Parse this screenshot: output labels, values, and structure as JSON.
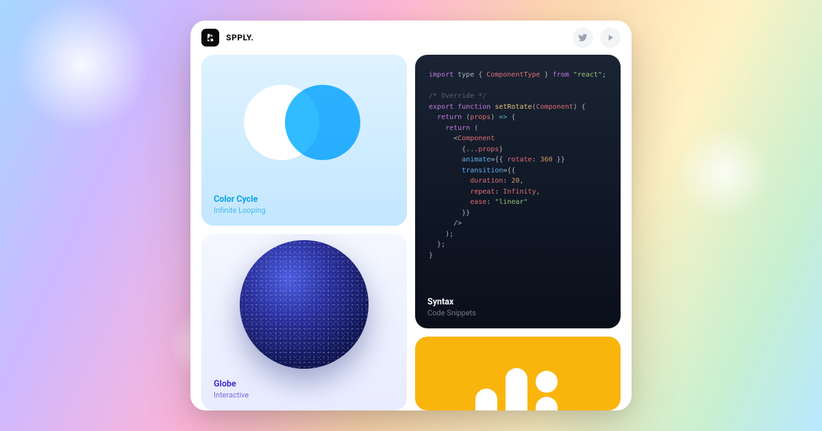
{
  "brand": "SPPLY.",
  "cards": {
    "cycle": {
      "title": "Color Cycle",
      "sub": "Infinite Looping"
    },
    "globe": {
      "title": "Globe",
      "sub": "Interactive"
    },
    "syntax": {
      "title": "Syntax",
      "sub": "Code Snippets"
    }
  },
  "code": {
    "lines": [
      [
        [
          "kw",
          "import"
        ],
        [
          "pn",
          " type "
        ],
        [
          "pn",
          "{ "
        ],
        [
          "id",
          "ComponentType"
        ],
        [
          "pn",
          " } "
        ],
        [
          "kw",
          "from"
        ],
        [
          "pn",
          " "
        ],
        [
          "str",
          "\"react\""
        ],
        [
          "pn",
          ";"
        ]
      ],
      [],
      [
        [
          "cm",
          "/* Override */"
        ]
      ],
      [
        [
          "kw",
          "export"
        ],
        [
          "pn",
          " "
        ],
        [
          "kw",
          "function"
        ],
        [
          "pn",
          " "
        ],
        [
          "fn",
          "setRotate"
        ],
        [
          "pn",
          "("
        ],
        [
          "id",
          "Component"
        ],
        [
          "pn",
          ") {"
        ]
      ],
      [
        [
          "pn",
          "  "
        ],
        [
          "kw",
          "return"
        ],
        [
          "pn",
          " ("
        ],
        [
          "id",
          "props"
        ],
        [
          "pn",
          ") "
        ],
        [
          "kw2",
          "=>"
        ],
        [
          "pn",
          " {"
        ]
      ],
      [
        [
          "pn",
          "    "
        ],
        [
          "kw",
          "return"
        ],
        [
          "pn",
          " ("
        ]
      ],
      [
        [
          "pn",
          "      <"
        ],
        [
          "id",
          "Component"
        ]
      ],
      [
        [
          "pn",
          "        {..."
        ],
        [
          "id",
          "props"
        ],
        [
          "pn",
          "}"
        ]
      ],
      [
        [
          "pn",
          "        "
        ],
        [
          "attr",
          "animate"
        ],
        [
          "pn",
          "={{ "
        ],
        [
          "id",
          "rotate"
        ],
        [
          "pn",
          ": "
        ],
        [
          "num",
          "360"
        ],
        [
          "pn",
          " }}"
        ]
      ],
      [
        [
          "pn",
          "        "
        ],
        [
          "attr",
          "transition"
        ],
        [
          "pn",
          "={{"
        ]
      ],
      [
        [
          "pn",
          "          "
        ],
        [
          "id",
          "duration"
        ],
        [
          "pn",
          ": "
        ],
        [
          "num",
          "20"
        ],
        [
          "pn",
          ","
        ]
      ],
      [
        [
          "pn",
          "          "
        ],
        [
          "id",
          "repeat"
        ],
        [
          "pn",
          ": "
        ],
        [
          "id",
          "Infinity"
        ],
        [
          "pn",
          ","
        ]
      ],
      [
        [
          "pn",
          "          "
        ],
        [
          "id",
          "ease"
        ],
        [
          "pn",
          ": "
        ],
        [
          "str",
          "\"linear\""
        ]
      ],
      [
        [
          "pn",
          "        }}"
        ]
      ],
      [
        [
          "pn",
          "      />"
        ]
      ],
      [
        [
          "pn",
          "    );"
        ]
      ],
      [
        [
          "pn",
          "  };"
        ]
      ],
      [
        [
          "pn",
          "}"
        ]
      ]
    ]
  },
  "colors": {
    "cycle_circle1": "#ffffff",
    "cycle_circle2": "#1fb6ff",
    "syntax_bg": "#111a27",
    "yellow": "#f9b50b"
  }
}
